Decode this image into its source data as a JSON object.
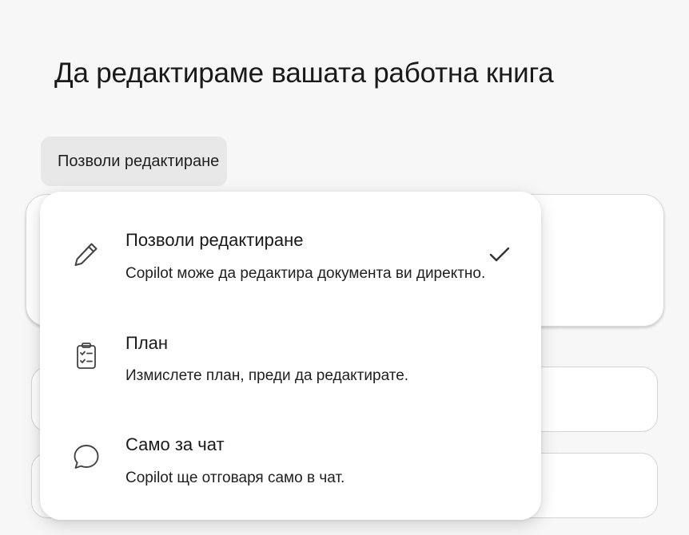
{
  "header": {
    "title": "Да редактираме вашата работна книга"
  },
  "mode_button": {
    "label": "Позволи редактиране"
  },
  "menu": {
    "selected_index": 0,
    "items": [
      {
        "icon": "pencil-icon",
        "title": "Позволи редактиране",
        "description": "Copilot може да редактира документа ви директно.",
        "selected": true
      },
      {
        "icon": "clipboard-checklist-icon",
        "title": "План",
        "description": "Измислете план, преди да редактирате.",
        "selected": false
      },
      {
        "icon": "chat-bubble-icon",
        "title": "Само за чат",
        "description": "Copilot ще отговаря само в чат.",
        "selected": false
      }
    ]
  },
  "colors": {
    "page_background": "#f7f7f7",
    "button_background": "#e8e8e8",
    "menu_background": "#ffffff",
    "text": "#1a1a1a",
    "icon": "#444444"
  }
}
